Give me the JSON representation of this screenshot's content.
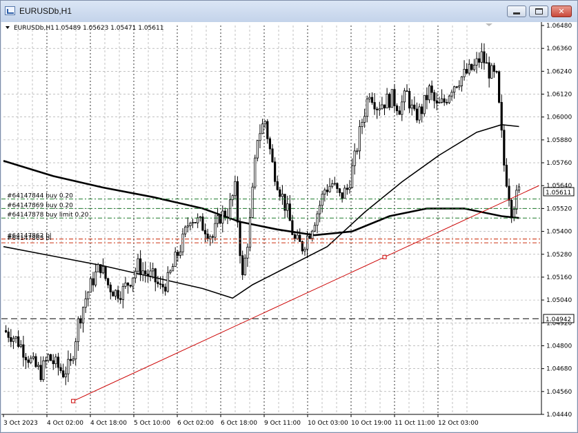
{
  "window": {
    "title": "EURUSDb,H1"
  },
  "chart_header": {
    "symbol": "EURUSDb,H1",
    "ohlc": "1.05489 1.05623 1.05471 1.05611"
  },
  "current_price_label": "1.05611",
  "level_label": "1.04942",
  "colors": {
    "candles": "#000000",
    "ma": "#000000",
    "trendline": "#cc0000",
    "orders_green": "#1b7a2a",
    "orders_red": "#d24a2e",
    "grid": "#9a9a9a",
    "background": "#ffffff"
  },
  "orders": [
    {
      "label": "#64147844 buy 0.20",
      "price": 1.0557
    },
    {
      "label": "#64147869 buy 0.20",
      "price": 1.0552
    },
    {
      "label": "#64147878 buy limit 0.20",
      "price": 1.0547
    }
  ],
  "red_orders": [
    {
      "label": "#64147862 bl",
      "price": 1.0536
    },
    {
      "label": "#64147863 bl",
      "price": 1.0534
    }
  ],
  "chart_data": {
    "type": "candlestick",
    "ylim": [
      1.0444,
      1.0648
    ],
    "y_ticks": [
      "1.06480",
      "1.06360",
      "1.06240",
      "1.06120",
      "1.06000",
      "1.05880",
      "1.05760",
      "1.05640",
      "1.05520",
      "1.05400",
      "1.05280",
      "1.05160",
      "1.05040",
      "1.04920",
      "1.04800",
      "1.04680",
      "1.04560",
      "1.04440"
    ],
    "x_ticks": [
      "3 Oct 2023",
      "4 Oct 02:00",
      "4 Oct 18:00",
      "5 Oct 10:00",
      "6 Oct 02:00",
      "6 Oct 18:00",
      "9 Oct 11:00",
      "10 Oct 03:00",
      "10 Oct 19:00",
      "11 Oct 11:00",
      "12 Oct 03:00"
    ],
    "close_path": [
      [
        0,
        1.0488
      ],
      [
        3,
        1.0486
      ],
      [
        6,
        1.0482
      ],
      [
        9,
        1.0476
      ],
      [
        12,
        1.047
      ],
      [
        15,
        1.0466
      ],
      [
        18,
        1.0474
      ],
      [
        21,
        1.047
      ],
      [
        24,
        1.0466
      ],
      [
        27,
        1.047
      ],
      [
        30,
        1.0492
      ],
      [
        33,
        1.0505
      ],
      [
        36,
        1.0515
      ],
      [
        39,
        1.0522
      ],
      [
        42,
        1.0512
      ],
      [
        45,
        1.0508
      ],
      [
        48,
        1.0509
      ],
      [
        51,
        1.0515
      ],
      [
        54,
        1.0522
      ],
      [
        57,
        1.0518
      ],
      [
        60,
        1.0516
      ],
      [
        63,
        1.051
      ],
      [
        66,
        1.0514
      ],
      [
        69,
        1.0525
      ],
      [
        72,
        1.0535
      ],
      [
        75,
        1.0548
      ],
      [
        78,
        1.0545
      ],
      [
        81,
        1.0542
      ],
      [
        84,
        1.0537
      ],
      [
        87,
        1.0548
      ],
      [
        90,
        1.055
      ],
      [
        93,
        1.0562
      ],
      [
        96,
        1.0515
      ],
      [
        99,
        1.0545
      ],
      [
        102,
        1.059
      ],
      [
        105,
        1.0598
      ],
      [
        108,
        1.0575
      ],
      [
        111,
        1.0562
      ],
      [
        114,
        1.055
      ],
      [
        117,
        1.0535
      ],
      [
        120,
        1.0532
      ],
      [
        123,
        1.054
      ],
      [
        126,
        1.055
      ],
      [
        129,
        1.0562
      ],
      [
        132,
        1.0565
      ],
      [
        135,
        1.0558
      ],
      [
        138,
        1.0562
      ],
      [
        141,
        1.0578
      ],
      [
        144,
        1.0598
      ],
      [
        147,
        1.0614
      ],
      [
        150,
        1.0606
      ],
      [
        153,
        1.0608
      ],
      [
        156,
        1.061
      ],
      [
        159,
        1.0605
      ],
      [
        162,
        1.0612
      ],
      [
        165,
        1.06
      ],
      [
        168,
        1.0604
      ],
      [
        171,
        1.0614
      ],
      [
        174,
        1.0605
      ],
      [
        177,
        1.0608
      ],
      [
        180,
        1.0616
      ],
      [
        183,
        1.062
      ],
      [
        186,
        1.0623
      ],
      [
        189,
        1.0626
      ],
      [
        192,
        1.0632
      ],
      [
        195,
        1.0624
      ],
      [
        198,
        1.062
      ],
      [
        201,
        1.0575
      ],
      [
        204,
        1.0552
      ],
      [
        207,
        1.0561
      ]
    ],
    "ma_fast": [
      [
        0,
        1.0577
      ],
      [
        20,
        1.0569
      ],
      [
        40,
        1.0563
      ],
      [
        60,
        1.0558
      ],
      [
        80,
        1.0552
      ],
      [
        95,
        1.0545
      ],
      [
        110,
        1.0541
      ],
      [
        125,
        1.0538
      ],
      [
        140,
        1.054
      ],
      [
        155,
        1.0548
      ],
      [
        170,
        1.0552
      ],
      [
        185,
        1.0552
      ],
      [
        200,
        1.0548
      ],
      [
        207,
        1.0547
      ]
    ],
    "ma_mid": [
      [
        0,
        1.0532
      ],
      [
        20,
        1.0527
      ],
      [
        40,
        1.0522
      ],
      [
        60,
        1.0516
      ],
      [
        80,
        1.051
      ],
      [
        92,
        1.0505
      ],
      [
        100,
        1.0512
      ],
      [
        115,
        1.0522
      ],
      [
        130,
        1.0532
      ],
      [
        145,
        1.055
      ],
      [
        160,
        1.0566
      ],
      [
        175,
        1.058
      ],
      [
        190,
        1.0592
      ],
      [
        200,
        1.0596
      ],
      [
        207,
        1.0595
      ]
    ],
    "trendline": [
      [
        28,
        1.0451
      ],
      [
        215,
        1.0564
      ]
    ]
  }
}
